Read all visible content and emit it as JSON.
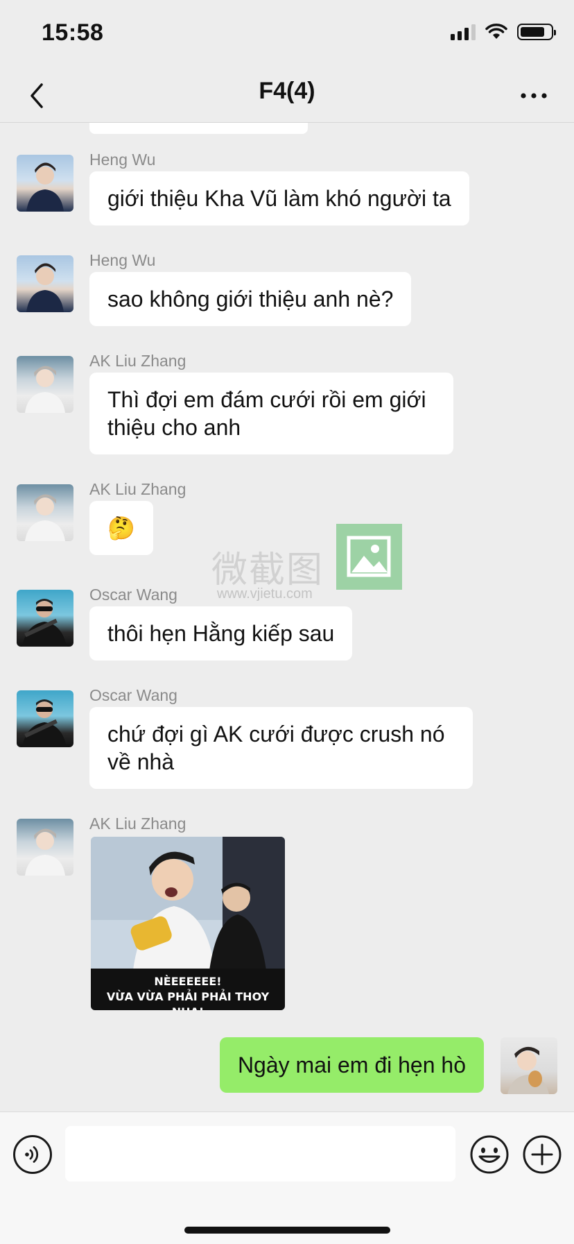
{
  "status": {
    "time": "15:58",
    "signal_icon": "cellular-signal-icon",
    "wifi_icon": "wifi-icon",
    "battery_icon": "battery-icon"
  },
  "nav": {
    "title": "F4(4)",
    "back_icon": "chevron-left-icon",
    "more_icon": "more-dots-icon"
  },
  "messages": [
    {
      "sender": "Heng Wu",
      "text": "giới thiệu Kha Vũ làm khó người ta"
    },
    {
      "sender": "Heng Wu",
      "text": "sao không giới thiệu anh nè?"
    },
    {
      "sender": "AK Liu Zhang",
      "text": "Thì đợi em đám cưới rồi em giới thiệu cho anh"
    },
    {
      "sender": "AK Liu Zhang",
      "text": "🤔"
    },
    {
      "sender": "Oscar Wang",
      "text": "thôi hẹn Hằng kiếp sau"
    },
    {
      "sender": "Oscar Wang",
      "text": "chứ đợi gì AK cưới được crush nó về nhà"
    },
    {
      "sender": "AK Liu Zhang",
      "sticker_caption_1": "NÈEEEEEE!",
      "sticker_caption_2": "VỪA VỪA PHẢI PHẢI THOY NHA!"
    }
  ],
  "my_message": {
    "text": "Ngày mai em đi hẹn hò"
  },
  "watermark": {
    "text": "微截图",
    "url": "www.vjietu.com"
  },
  "input": {
    "value": "",
    "voice_icon": "voice-icon",
    "emoji_icon": "emoji-icon",
    "plus_icon": "plus-icon"
  },
  "colors": {
    "background": "#ededed",
    "my_bubble": "#95ec69",
    "their_bubble": "#ffffff",
    "sender_name": "#8a8a8a"
  }
}
